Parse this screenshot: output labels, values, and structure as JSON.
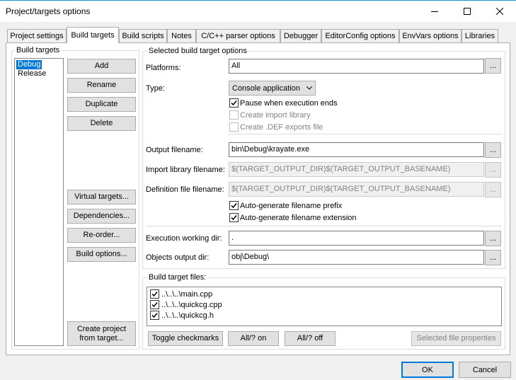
{
  "window": {
    "title": "Project/targets options",
    "minimize_glyph": "—",
    "maximize_glyph": "☐",
    "close_glyph": "✕"
  },
  "tabs": [
    {
      "label": "Project settings"
    },
    {
      "label": "Build targets"
    },
    {
      "label": "Build scripts"
    },
    {
      "label": "Notes"
    },
    {
      "label": "C/C++ parser options"
    },
    {
      "label": "Debugger"
    },
    {
      "label": "EditorConfig options"
    },
    {
      "label": "EnvVars options"
    },
    {
      "label": "Libraries"
    }
  ],
  "build_targets": {
    "group_label": "Build targets",
    "items": [
      {
        "label": "Debug",
        "selected": true
      },
      {
        "label": "Release",
        "selected": false
      }
    ],
    "buttons": {
      "add": "Add",
      "rename": "Rename",
      "duplicate": "Duplicate",
      "delete": "Delete",
      "virtual_targets": "Virtual targets...",
      "dependencies": "Dependencies...",
      "reorder": "Re-order...",
      "build_options": "Build options...",
      "create_project": "Create project\nfrom target..."
    }
  },
  "options": {
    "group_label": "Selected build target options",
    "platforms_label": "Platforms:",
    "platforms_value": "All",
    "type_label": "Type:",
    "type_value": "Console application",
    "pause_label": "Pause when execution ends",
    "pause_checked": true,
    "create_import_label": "Create import library",
    "create_import_checked": false,
    "create_def_label": "Create .DEF exports file",
    "create_def_checked": false,
    "output_filename_label": "Output filename:",
    "output_filename_value": "bin\\Debug\\krayate.exe",
    "import_library_label": "Import library filename:",
    "import_library_value": "$(TARGET_OUTPUT_DIR)$(TARGET_OUTPUT_BASENAME)",
    "definition_file_label": "Definition file filename:",
    "definition_file_value": "$(TARGET_OUTPUT_DIR)$(TARGET_OUTPUT_BASENAME)",
    "auto_prefix_label": "Auto-generate filename prefix",
    "auto_prefix_checked": true,
    "auto_ext_label": "Auto-generate filename extension",
    "auto_ext_checked": true,
    "exec_dir_label": "Execution working dir:",
    "exec_dir_value": ".",
    "objects_dir_label": "Objects output dir:",
    "objects_dir_value": "obj\\Debug\\",
    "ellipsis": "..."
  },
  "files": {
    "group_label": "Build target files:",
    "items": [
      {
        "label": "..\\..\\..\\main.cpp",
        "checked": true
      },
      {
        "label": "..\\..\\..\\quickcg.cpp",
        "checked": true
      },
      {
        "label": "..\\..\\..\\quickcg.h",
        "checked": true
      }
    ],
    "toggle_label": "Toggle checkmarks",
    "all_on_label": "All/? on",
    "all_off_label": "All/? off",
    "selected_props_label": "Selected file properties"
  },
  "dialog": {
    "ok_label": "OK",
    "cancel_label": "Cancel"
  },
  "colors": {
    "accent": "#0078d7",
    "title_border": "#1a8fd6"
  }
}
